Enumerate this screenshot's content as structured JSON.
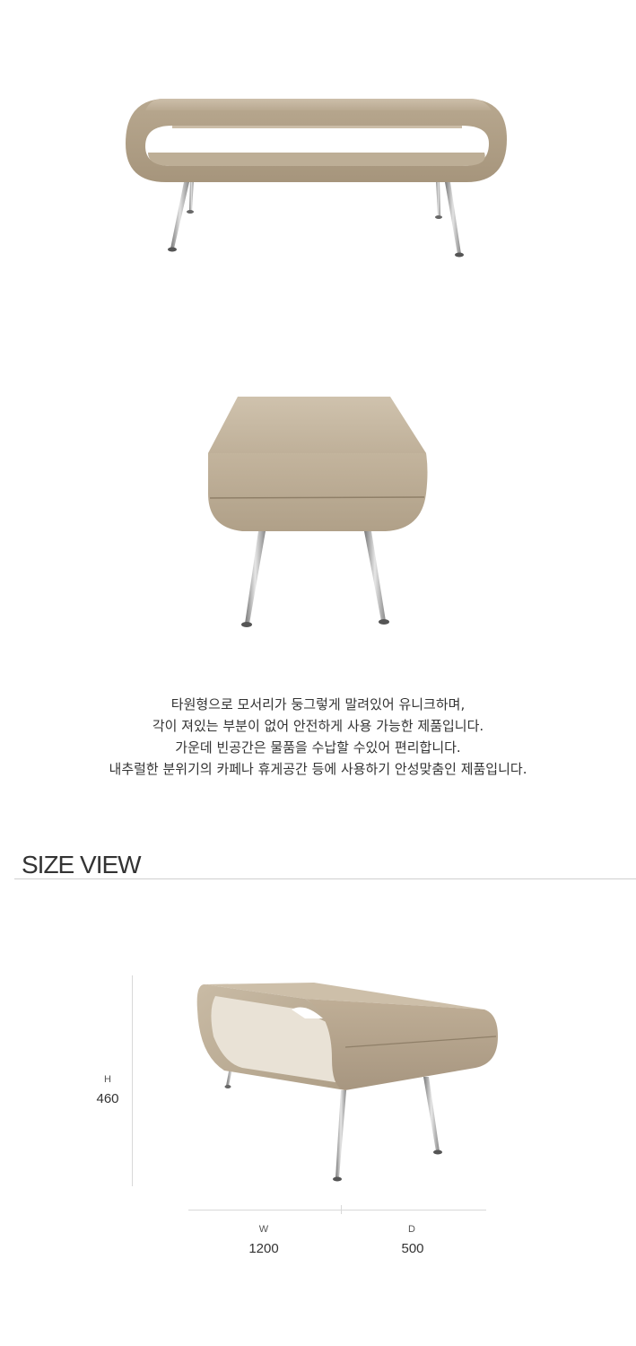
{
  "description": {
    "lines": [
      "타원형으로 모서리가 둥그렇게 말려있어 유니크하며,",
      "각이 져있는 부분이 없어 안전하게 사용 가능한 제품입니다.",
      "가운데 빈공간은 물품을 수납할 수있어 편리합니다.",
      "내추럴한 분위기의 카페나 휴게공간 등에 사용하기 안성맞춤인 제품입니다."
    ]
  },
  "size_view": {
    "title": "SIZE VIEW",
    "height": {
      "letter": "H",
      "value": "460"
    },
    "width": {
      "letter": "W",
      "value": "1200"
    },
    "depth": {
      "letter": "D",
      "value": "500"
    }
  },
  "colors": {
    "wood_light": "#c9bba6",
    "wood_mid": "#b5a68f",
    "wood_dark": "#9c8c74",
    "chrome": "#a9a9a9"
  }
}
